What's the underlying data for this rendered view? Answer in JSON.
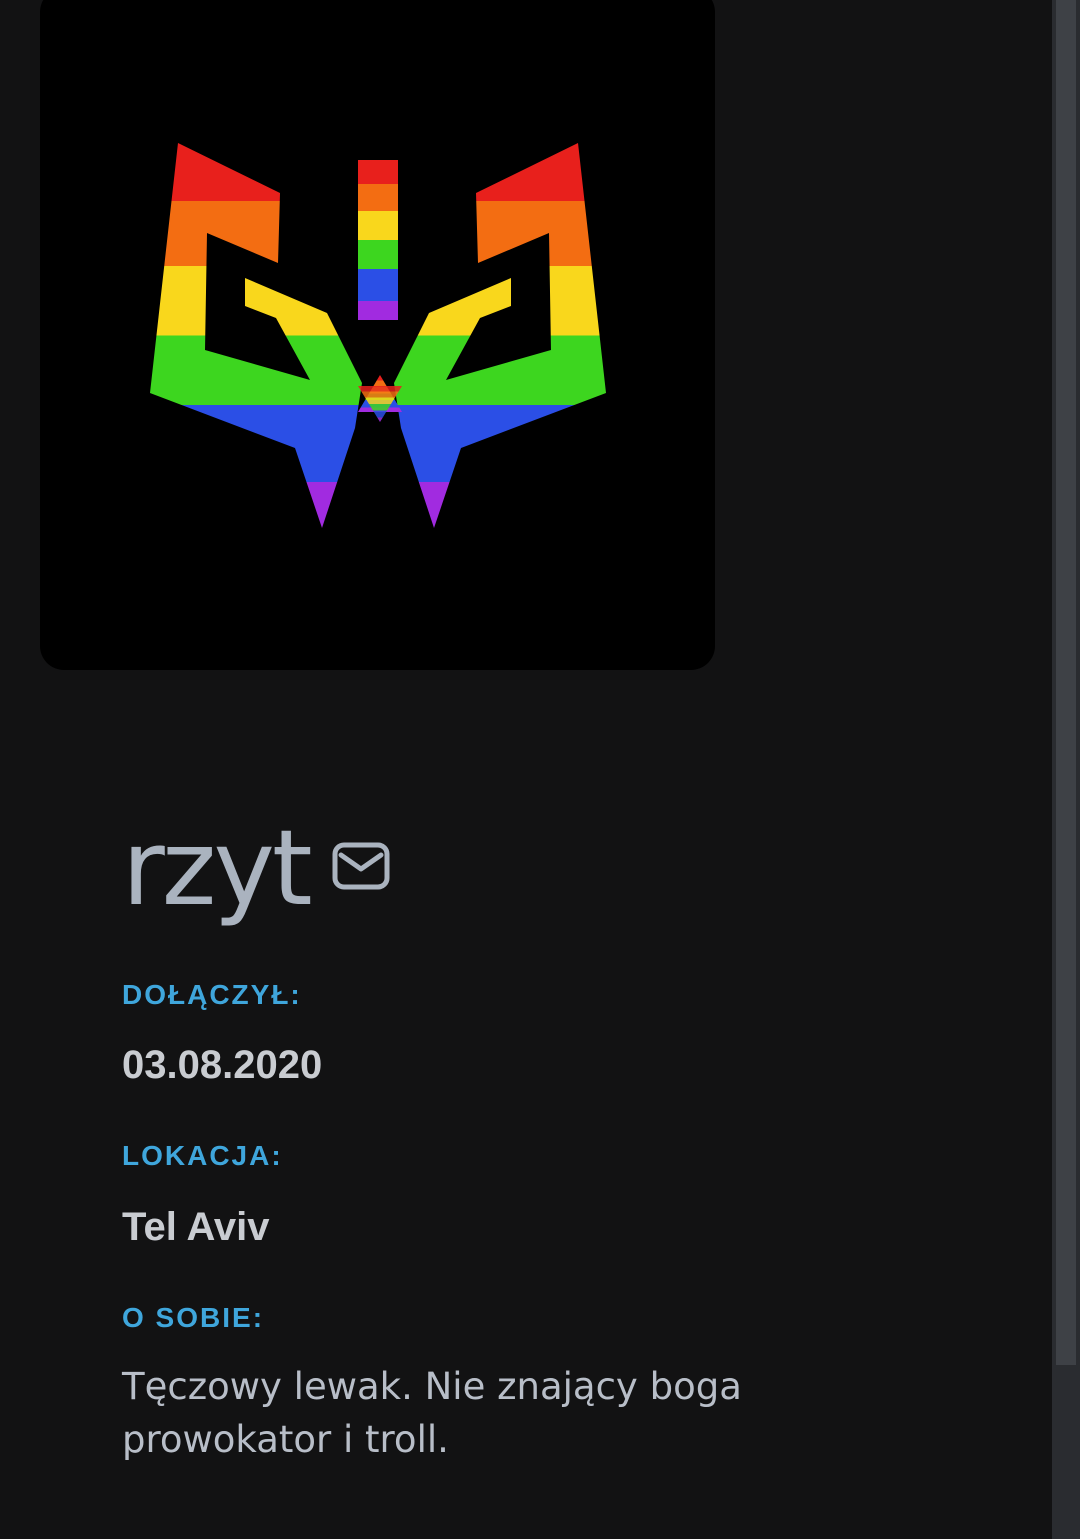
{
  "profile": {
    "username": "rzyt",
    "message_icon": "mail-icon",
    "avatar_icon": "rainbow-trident-emblem",
    "fields": {
      "joined_label": "DOŁĄCZYŁ:",
      "joined_value": "03.08.2020",
      "location_label": "LOKACJA:",
      "location_value": "Tel Aviv",
      "about_label": "O SOBIE:",
      "about_value": "Tęczowy lewak. Nie znający boga prowokator i troll."
    }
  },
  "colors": {
    "background": "#121213",
    "label_accent": "#3fa6dc",
    "username": "#aab3bf",
    "value_text": "#c9ccd1",
    "rainbow": [
      "#e8201c",
      "#f36d12",
      "#f9d71c",
      "#3dd61f",
      "#2b4fe6",
      "#a12be0"
    ]
  }
}
